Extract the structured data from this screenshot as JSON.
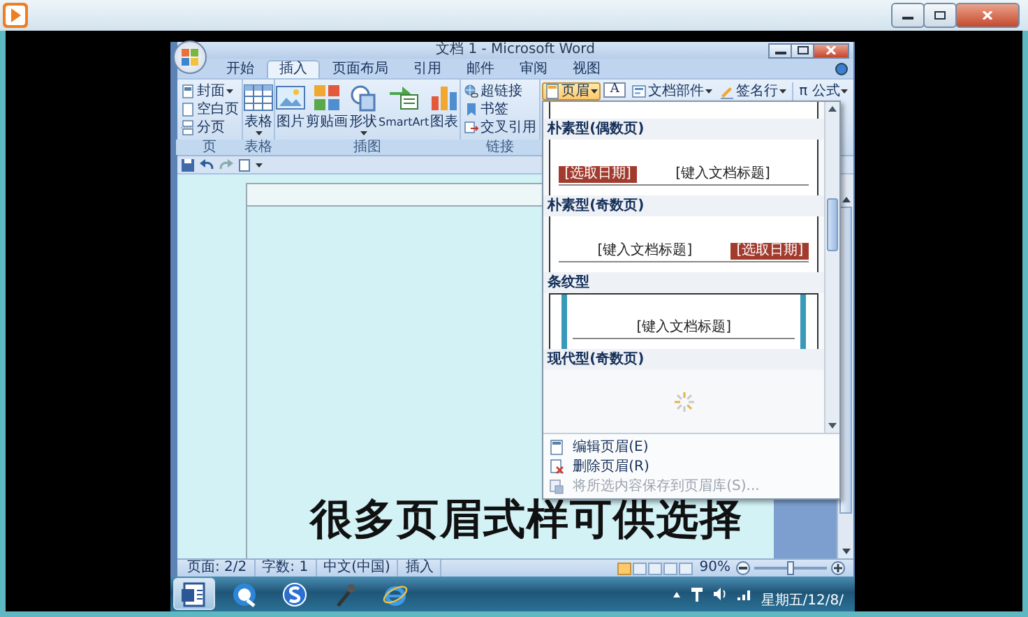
{
  "word": {
    "title": "文档 1 - Microsoft Word",
    "tabs": [
      {
        "label": "开始",
        "selected": false
      },
      {
        "label": "插入",
        "selected": true
      },
      {
        "label": "页面布局",
        "selected": false
      },
      {
        "label": "引用",
        "selected": false
      },
      {
        "label": "邮件",
        "selected": false
      },
      {
        "label": "审阅",
        "selected": false
      },
      {
        "label": "视图",
        "selected": false
      }
    ],
    "ribbon_groups": [
      {
        "label": "页",
        "kind": "small",
        "items": [
          {
            "label": "封面",
            "dropdown": true
          },
          {
            "label": "空白页",
            "dropdown": false
          },
          {
            "label": "分页",
            "dropdown": false
          }
        ]
      },
      {
        "label": "表格",
        "kind": "large",
        "items": [
          {
            "label": "表格",
            "dropdown": true
          }
        ]
      },
      {
        "label": "插图",
        "kind": "large",
        "items": [
          {
            "label": "图片",
            "dropdown": false
          },
          {
            "label": "剪贴画",
            "dropdown": false
          },
          {
            "label": "形状",
            "dropdown": true
          },
          {
            "label": "SmartArt",
            "dropdown": false
          },
          {
            "label": "图表",
            "dropdown": false
          }
        ]
      },
      {
        "label": "链接",
        "kind": "small",
        "items": [
          {
            "label": "超链接",
            "dropdown": false
          },
          {
            "label": "书签",
            "dropdown": false
          },
          {
            "label": "交叉引用",
            "dropdown": false
          }
        ]
      }
    ],
    "header_group": [
      {
        "kind": "split",
        "label": "页眉",
        "dropdown": true,
        "selected": true
      },
      {
        "kind": "text-box",
        "label": "A",
        "dropdown": false,
        "selected": false
      },
      {
        "kind": "split",
        "label": "文档部件",
        "dropdown": true,
        "selected": false
      },
      {
        "kind": "split",
        "label": "签名行",
        "dropdown": true,
        "selected": false
      },
      {
        "kind": "split",
        "label": "π 公式",
        "dropdown": true,
        "selected": false
      }
    ],
    "header_gallery": {
      "sections": [
        {
          "kind": "partial"
        },
        {
          "kind": "plain-even",
          "label": "朴素型(偶数页)",
          "date": "[选取日期]",
          "doc_title": "[键入文档标题]"
        },
        {
          "kind": "plain-odd",
          "label": "朴素型(奇数页)",
          "date": "[选取日期]",
          "doc_title": "[键入文档标题]"
        },
        {
          "kind": "stripes",
          "label": "条纹型",
          "doc_title": "[键入文档标题]"
        },
        {
          "kind": "loading",
          "label": "现代型(奇数页)"
        }
      ],
      "menu": [
        {
          "label": "编辑页眉(E)",
          "disabled": false
        },
        {
          "label": "删除页眉(R)",
          "disabled": false
        },
        {
          "label": "将所选内容保存到页眉库(S)...",
          "disabled": true
        }
      ]
    },
    "caption": "很多页眉式样可供选择",
    "status_bar": {
      "items": [
        "页面: 2/2",
        "字数: 1",
        "中文(中国)",
        "插入"
      ],
      "views": [
        {
          "selected": true
        },
        {
          "selected": false
        },
        {
          "selected": false
        },
        {
          "selected": false
        },
        {
          "selected": false
        }
      ],
      "zoom": {
        "reading": "90%",
        "level": 0.5
      }
    }
  },
  "taskbar": {
    "apps": [
      {
        "selected": true
      },
      {
        "selected": false
      },
      {
        "selected": false
      },
      {
        "selected": false
      },
      {
        "selected": false
      }
    ],
    "date": "星期五/12/8/"
  }
}
